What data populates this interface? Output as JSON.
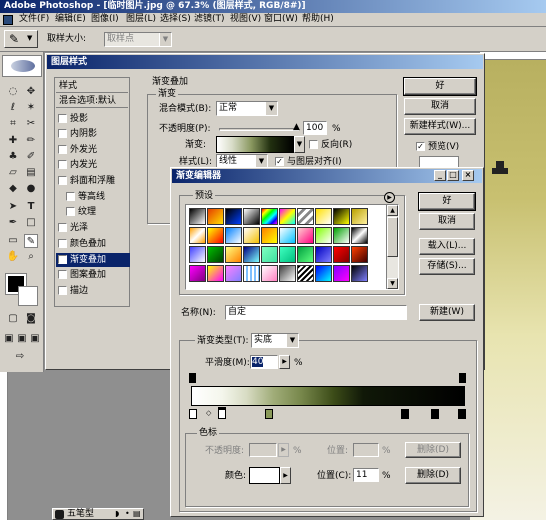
{
  "app": {
    "title": "Adobe Photoshop - [临时图片.jpg @ 67.3% (图层样式, RGB/8#)]"
  },
  "menu": [
    "文件(F)",
    "编辑(E)",
    "图像(I)",
    "图层(L)",
    "选择(S)",
    "滤镜(T)",
    "视图(V)",
    "窗口(W)",
    "帮助(H)"
  ],
  "options": {
    "sample_label": "取样大小:",
    "sample_value": "取样点"
  },
  "layer_style": {
    "title": "图层样式",
    "styles_header": "样式",
    "blend_options": "混合选项:默认",
    "items": [
      {
        "label": "投影",
        "checked": false
      },
      {
        "label": "内阴影",
        "checked": false
      },
      {
        "label": "外发光",
        "checked": false
      },
      {
        "label": "内发光",
        "checked": false
      },
      {
        "label": "斜面和浮雕",
        "checked": false
      },
      {
        "label": "等高线",
        "checked": false
      },
      {
        "label": "纹理",
        "checked": false
      },
      {
        "label": "光泽",
        "checked": false
      },
      {
        "label": "颜色叠加",
        "checked": false
      },
      {
        "label": "渐变叠加",
        "checked": true
      },
      {
        "label": "图案叠加",
        "checked": false
      },
      {
        "label": "描边",
        "checked": false
      }
    ],
    "section_title": "渐变叠加",
    "subsection": "渐变",
    "blend_mode_label": "混合模式(B):",
    "blend_mode_value": "正常",
    "opacity_label": "不透明度(P):",
    "opacity_value": "100",
    "opacity_unit": "%",
    "gradient_label": "渐变:",
    "reverse_label": "反向(R)",
    "style_label": "样式(L):",
    "style_value": "线性",
    "align_label": "与图层对齐(I)",
    "ok": "好",
    "cancel": "取消",
    "new_style": "新建样式(W)...",
    "preview": "预览(V)"
  },
  "gradient_editor": {
    "title": "渐变编辑器",
    "presets_label": "预设",
    "ok": "好",
    "cancel": "取消",
    "load": "载入(L)...",
    "save": "存储(S)...",
    "name_label": "名称(N):",
    "name_value": "自定",
    "new": "新建(W)",
    "type_label": "渐变类型(T):",
    "type_value": "实底",
    "smooth_label": "平滑度(M):",
    "smooth_value": "40",
    "smooth_unit": "%",
    "stops_label": "色标",
    "opacity_label": "不透明度:",
    "opacity_unit": "%",
    "loc_label": "位置:",
    "loc_unit": "%",
    "delete": "删除(D)",
    "color_label": "颜色:",
    "color_loc_label": "位置(C):",
    "color_loc_value": "11",
    "color_loc_unit": "%",
    "delete2": "删除(D)"
  },
  "bottom_tab": "五笔型",
  "colors": {
    "titlebar": "#0a246a",
    "face": "#d4d0c8",
    "selection": "#0a246a",
    "canvas": "#b8b060"
  }
}
